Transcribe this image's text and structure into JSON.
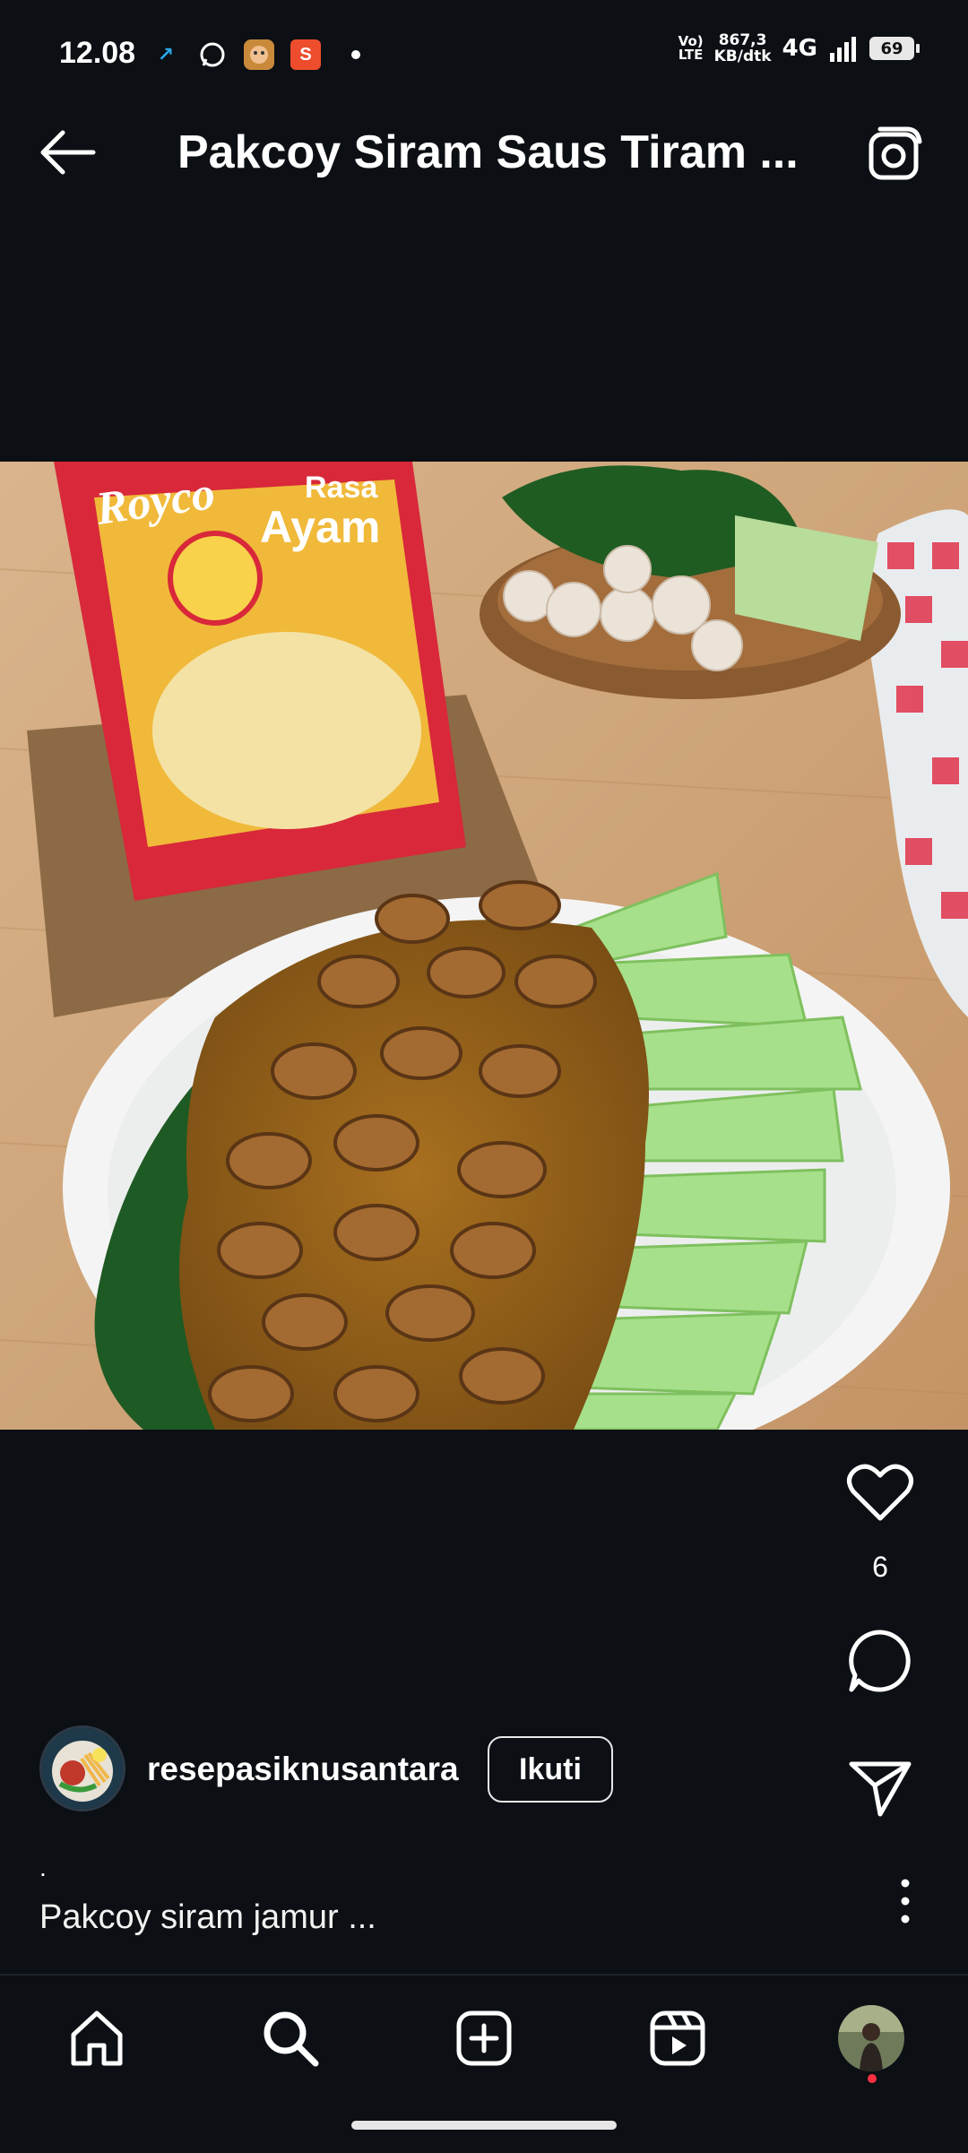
{
  "status_bar": {
    "time": "12.08",
    "notification_icons": [
      "recorder-icon",
      "whatsapp-icon",
      "game-icon",
      "shopee-icon"
    ],
    "lte_label_top": "Vo)",
    "lte_label_bottom": "LTE",
    "speed_value": "867,3",
    "speed_unit": "KB/dtk",
    "network": "4G",
    "battery": "69"
  },
  "header": {
    "title": "Pakcoy Siram Saus Tiram ...",
    "back_icon": "back-arrow-icon",
    "camera_icon": "camera-icon"
  },
  "post": {
    "image_alt": "Bok choy with mushroom oyster sauce on a white plate beside a Royco seasoning pack",
    "package_brand": "Royco",
    "package_text_1": "Rasa",
    "package_text_2": "Ayam",
    "likes": "6",
    "author": "resepasiknusantara",
    "follow_label": "Ikuti",
    "caption_dot": ".",
    "caption": "Pakcoy siram jamur ..."
  },
  "nav": {
    "items": [
      "home-icon",
      "search-icon",
      "create-icon",
      "reels-icon",
      "profile-avatar"
    ]
  },
  "colors": {
    "background": "#0c0f14",
    "text": "#ffffff",
    "notification_dot": "#ff3040"
  }
}
